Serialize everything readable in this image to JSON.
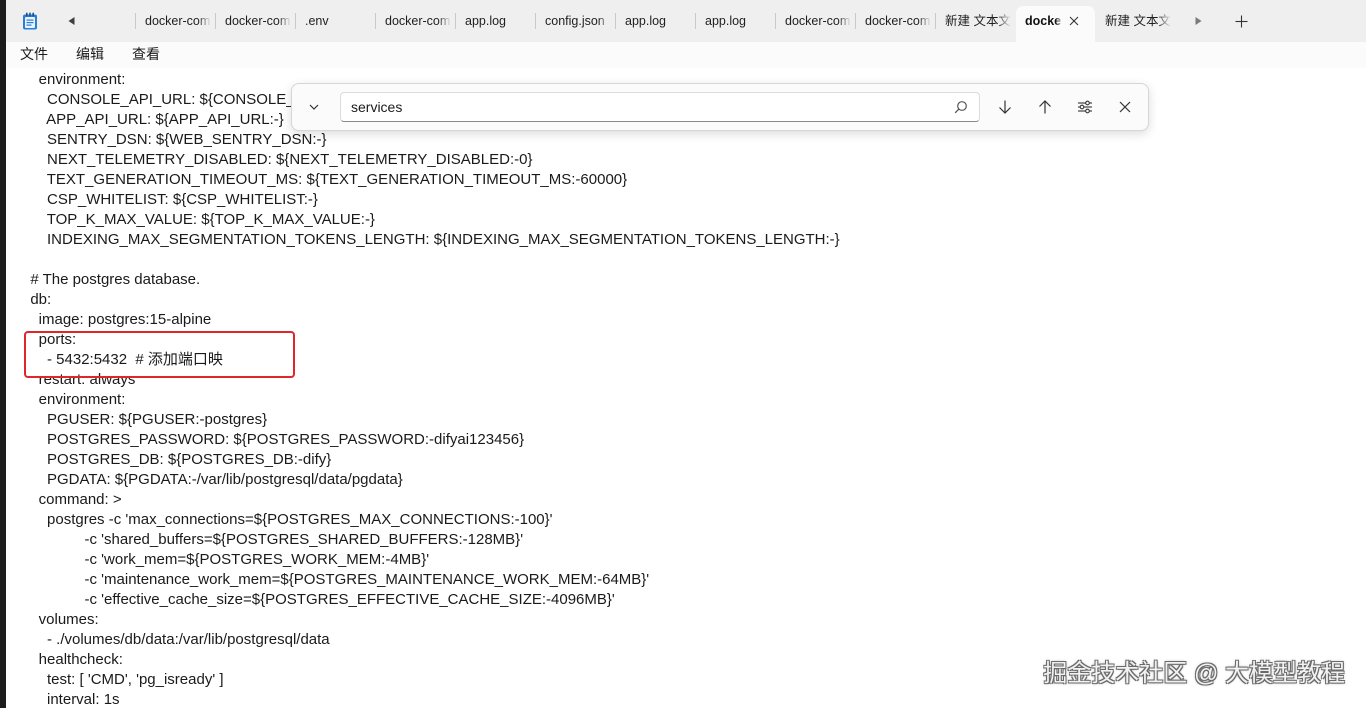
{
  "app": {
    "icon": "notepad-icon"
  },
  "tabs": {
    "scroll_left_icon": "caret-left-icon",
    "scroll_right_icon": "caret-right-icon",
    "new_tab_icon": "plus-icon",
    "close_icon": "close-icon",
    "items": [
      {
        "label": "docker-comp",
        "active": false
      },
      {
        "label": "docker-comp",
        "active": false
      },
      {
        "label": ".env",
        "active": false
      },
      {
        "label": "docker-comp",
        "active": false
      },
      {
        "label": "app.log",
        "active": false
      },
      {
        "label": "config.json",
        "active": false
      },
      {
        "label": "app.log",
        "active": false
      },
      {
        "label": "app.log",
        "active": false
      },
      {
        "label": "docker-comp",
        "active": false
      },
      {
        "label": "docker-comp",
        "active": false
      },
      {
        "label": "新建 文本文",
        "active": false
      },
      {
        "label": "docke",
        "active": true
      },
      {
        "label": "新建 文本文",
        "active": false
      }
    ]
  },
  "menu": {
    "items": [
      {
        "label": "文件"
      },
      {
        "label": "编辑"
      },
      {
        "label": "查看"
      }
    ]
  },
  "find": {
    "value": "services",
    "icons": {
      "toggle": "chevron-down-icon",
      "search": "search-icon",
      "next": "arrow-down-icon",
      "previous": "arrow-up-icon",
      "options": "sliders-icon",
      "close": "close-icon"
    }
  },
  "editor": {
    "lines": [
      "    environment:",
      "      CONSOLE_API_URL: ${CONSOLE_A",
      "      APP_API_URL: ${APP_API_URL:-}",
      "      SENTRY_DSN: ${WEB_SENTRY_DSN:-}",
      "      NEXT_TELEMETRY_DISABLED: ${NEXT_TELEMETRY_DISABLED:-0}",
      "      TEXT_GENERATION_TIMEOUT_MS: ${TEXT_GENERATION_TIMEOUT_MS:-60000}",
      "      CSP_WHITELIST: ${CSP_WHITELIST:-}",
      "      TOP_K_MAX_VALUE: ${TOP_K_MAX_VALUE:-}",
      "      INDEXING_MAX_SEGMENTATION_TOKENS_LENGTH: ${INDEXING_MAX_SEGMENTATION_TOKENS_LENGTH:-}",
      "",
      "  # The postgres database.",
      "  db:",
      "    image: postgres:15-alpine",
      "    ports:",
      "      - 5432:5432  # 添加端口映",
      "    restart: always",
      "    environment:",
      "      PGUSER: ${PGUSER:-postgres}",
      "      POSTGRES_PASSWORD: ${POSTGRES_PASSWORD:-difyai123456}",
      "      POSTGRES_DB: ${POSTGRES_DB:-dify}",
      "      PGDATA: ${PGDATA:-/var/lib/postgresql/data/pgdata}",
      "    command: >",
      "      postgres -c 'max_connections=${POSTGRES_MAX_CONNECTIONS:-100}'",
      "               -c 'shared_buffers=${POSTGRES_SHARED_BUFFERS:-128MB}'",
      "               -c 'work_mem=${POSTGRES_WORK_MEM:-4MB}'",
      "               -c 'maintenance_work_mem=${POSTGRES_MAINTENANCE_WORK_MEM:-64MB}'",
      "               -c 'effective_cache_size=${POSTGRES_EFFECTIVE_CACHE_SIZE:-4096MB}'",
      "    volumes:",
      "      - ./volumes/db/data:/var/lib/postgresql/data",
      "    healthcheck:",
      "      test: [ 'CMD', 'pg_isready' ]",
      "      interval: 1s"
    ]
  },
  "watermark": {
    "text": "掘金技术社区 @ 大模型教程"
  },
  "colors": {
    "tab_bar": "#efefef",
    "active_tab": "#fbfbfb",
    "menu_bar": "#fbfbfb",
    "editor_bg": "#ffffff",
    "text": "#1a1a1a",
    "highlight": "#e0262a",
    "terminal_bg": "#1c1c1c"
  }
}
